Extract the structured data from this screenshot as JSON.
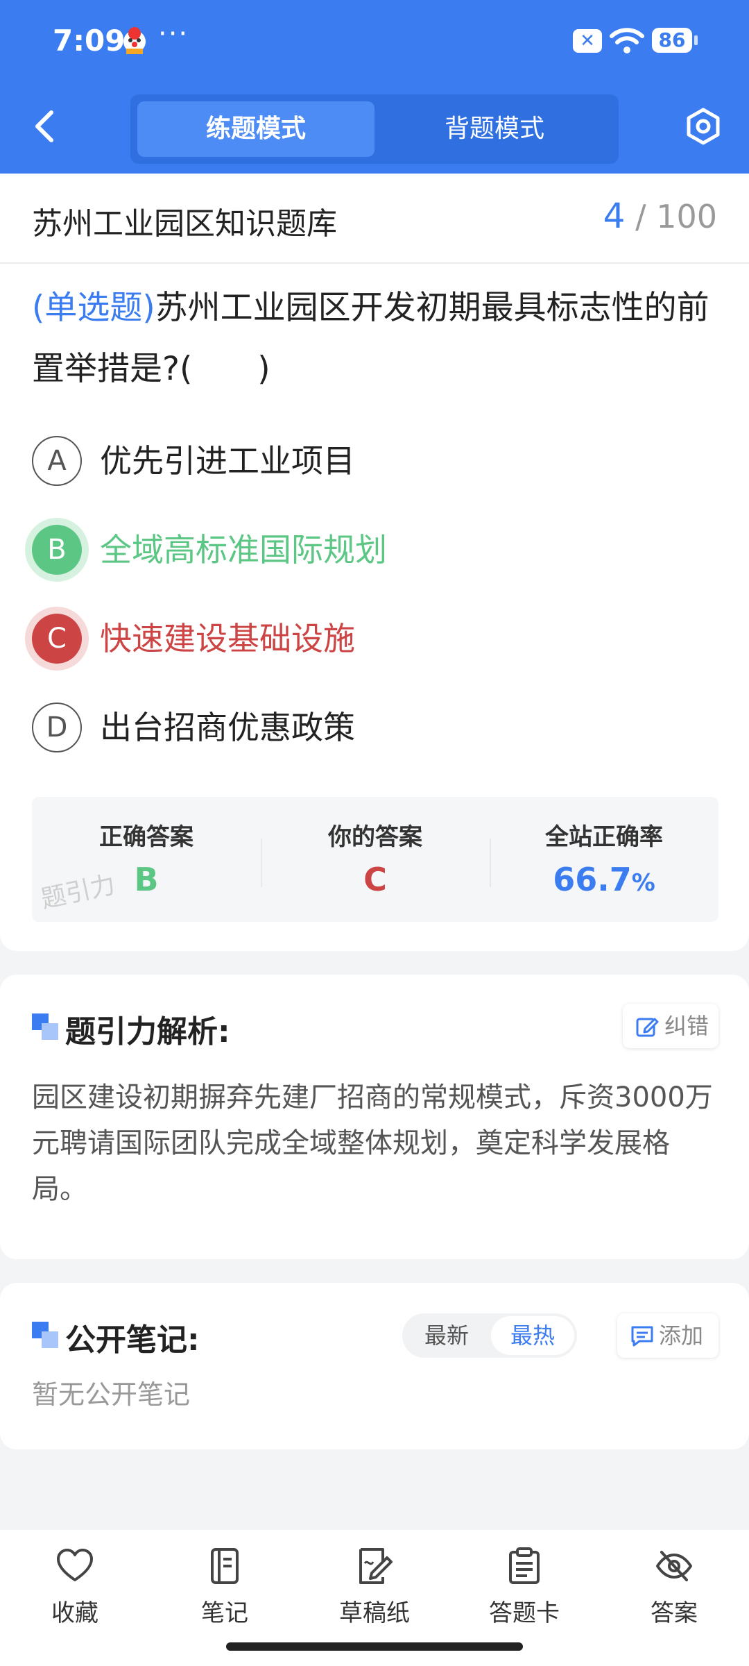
{
  "status_bar": {
    "time": "7:09",
    "dots": "···",
    "x_badge": "✕",
    "battery": "86"
  },
  "header": {
    "tabs": [
      {
        "label": "练题模式",
        "active": true
      },
      {
        "label": "背题模式",
        "active": false
      }
    ],
    "icons": [
      "back-arrow-icon",
      "settings-hexagon-icon"
    ]
  },
  "bank": {
    "title": "苏州工业园区知识题库",
    "current": "4",
    "separator": "/",
    "total": "100"
  },
  "question": {
    "type": "(单选题)",
    "text": "苏州工业园区开发初期最具标志性的前置举措是?(　　)"
  },
  "options": [
    {
      "letter": "A",
      "text": "优先引进工业项目",
      "state": "normal"
    },
    {
      "letter": "B",
      "text": "全域高标准国际规划",
      "state": "correct"
    },
    {
      "letter": "C",
      "text": "快速建设基础设施",
      "state": "wrong"
    },
    {
      "letter": "D",
      "text": "出台招商优惠政策",
      "state": "normal"
    }
  ],
  "stats": {
    "correct_label": "正确答案",
    "correct_value": "B",
    "yours_label": "你的答案",
    "yours_value": "C",
    "rate_label": "全站正确率",
    "rate_value": "66.7",
    "rate_unit": "%",
    "watermark": "题引力"
  },
  "analysis": {
    "title": "题引力解析:",
    "report_label": "纠错",
    "text": "园区建设初期摒弃先建厂招商的常规模式，斥资3000万元聘请国际团队完成全域整体规划，奠定科学发展格局。"
  },
  "notes": {
    "title": "公开笔记:",
    "sort_new": "最新",
    "sort_hot": "最热",
    "add_label": "添加",
    "empty": "暂无公开笔记"
  },
  "bottom_nav": [
    {
      "label": "收藏",
      "icon": "heart-icon"
    },
    {
      "label": "笔记",
      "icon": "notebook-icon"
    },
    {
      "label": "草稿纸",
      "icon": "draft-paper-icon"
    },
    {
      "label": "答题卡",
      "icon": "answer-sheet-icon"
    },
    {
      "label": "答案",
      "icon": "eye-off-icon"
    }
  ],
  "colors": {
    "primary": "#3b7df0",
    "correct": "#5cc784",
    "wrong": "#cc4444"
  }
}
